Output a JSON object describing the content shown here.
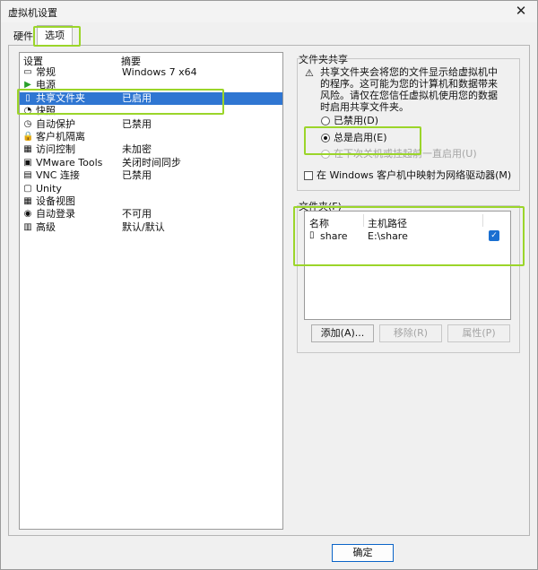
{
  "window": {
    "title": "虚拟机设置",
    "close_glyph": "✕"
  },
  "tabs": {
    "hardware": "硬件",
    "options": "选项"
  },
  "settings": {
    "header": {
      "name": "设置",
      "summary": "摘要"
    },
    "items": [
      {
        "name": "常规",
        "value": "Windows 7 x64",
        "icon": "general-icon",
        "glyph": "▭"
      },
      {
        "name": "电源",
        "value": "",
        "icon": "power-icon",
        "glyph": "▶"
      },
      {
        "name": "共享文件夹",
        "value": "已启用",
        "icon": "shared-folder-icon",
        "glyph": "▯"
      },
      {
        "name": "快照",
        "value": "",
        "icon": "snapshot-icon",
        "glyph": "◔"
      },
      {
        "name": "自动保护",
        "value": "已禁用",
        "icon": "autoprotect-icon",
        "glyph": "◷"
      },
      {
        "name": "客户机隔离",
        "value": "",
        "icon": "lock-icon",
        "glyph": "🔒"
      },
      {
        "name": "访问控制",
        "value": "未加密",
        "icon": "access-control-icon",
        "glyph": "▦"
      },
      {
        "name": "VMware Tools",
        "value": "关闭时间同步",
        "icon": "vmware-tools-icon",
        "glyph": "▣"
      },
      {
        "name": "VNC 连接",
        "value": "已禁用",
        "icon": "vnc-icon",
        "glyph": "▤"
      },
      {
        "name": "Unity",
        "value": "",
        "icon": "unity-icon",
        "glyph": "▢"
      },
      {
        "name": "设备视图",
        "value": "",
        "icon": "device-view-icon",
        "glyph": "▦"
      },
      {
        "name": "自动登录",
        "value": "不可用",
        "icon": "autologon-icon",
        "glyph": "◉"
      },
      {
        "name": "高级",
        "value": "默认/默认",
        "icon": "advanced-icon",
        "glyph": "▥"
      }
    ]
  },
  "folder_sharing": {
    "title": "文件夹共享",
    "warning_glyph": "⚠",
    "warning_line1": "共享文件夹会将您的文件显示给虚拟机中",
    "warning_line2": "的程序。这可能为您的计算机和数据带来",
    "warning_line3": "风险。请仅在您信任虚拟机使用您的数据",
    "warning_line4": "时启用共享文件夹。",
    "opt_disabled": "已禁用(D)",
    "opt_always": "总是启用(E)",
    "opt_until_off": "在下次关机或挂起前一直启用(U)",
    "map_drive": "在 Windows 客户机中映射为网络驱动器(M)"
  },
  "folders": {
    "title": "文件夹(F)",
    "col_name": "名称",
    "col_path": "主机路径",
    "rows": [
      {
        "name": "share",
        "path": "E:\\share",
        "enabled_glyph": "✓"
      }
    ],
    "add": "添加(A)...",
    "remove": "移除(R)",
    "properties": "属性(P)"
  },
  "ok": "确定",
  "colors": {
    "selection": "#2f76d2",
    "annotation": "#9bd52a",
    "checkbox": "#1a6fd1"
  }
}
